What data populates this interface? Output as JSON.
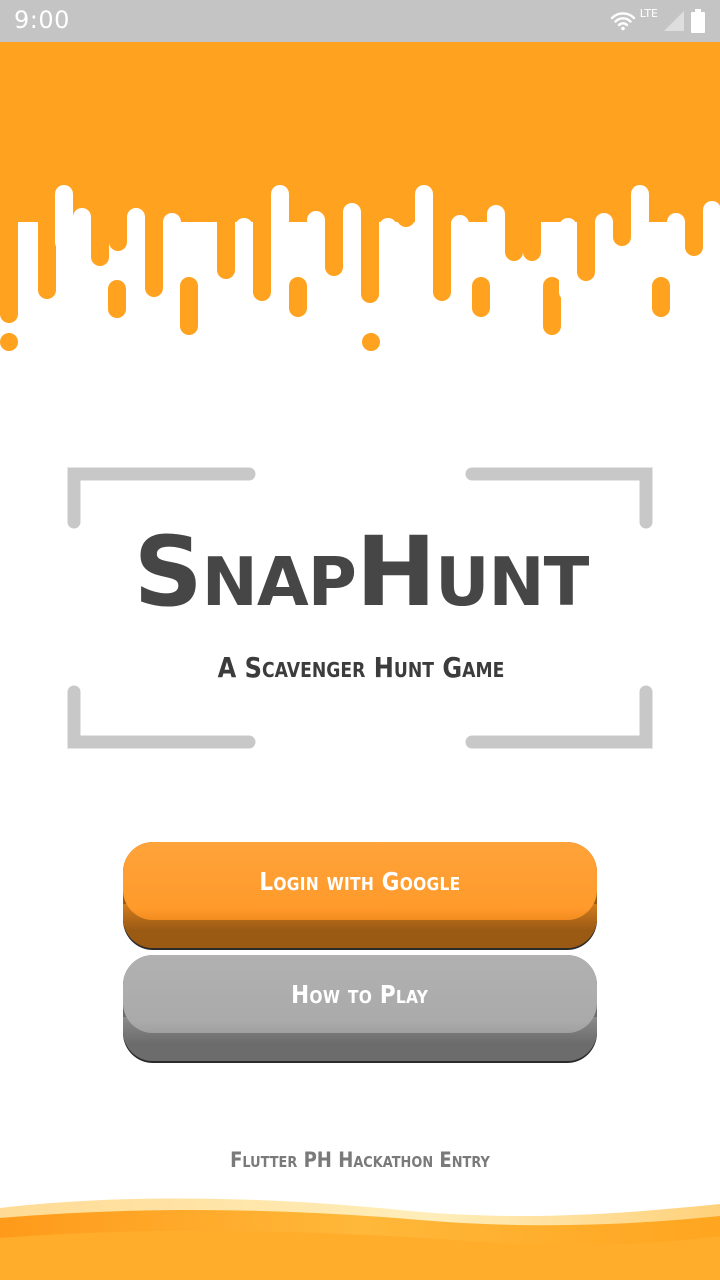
{
  "status_bar": {
    "time": "9:00",
    "network": "LTE",
    "icons": [
      "wifi-icon",
      "signal-icon",
      "battery-icon"
    ]
  },
  "logo": {
    "title": "SnapHunt",
    "subtitle": "A Scavenger Hunt Game"
  },
  "buttons": {
    "login_label": "Login with Google",
    "how_to_play_label": "How to Play"
  },
  "footer": {
    "text": "Flutter PH Hackathon Entry"
  },
  "colors": {
    "accent_orange": "#ffa21f",
    "button_orange": "#ff9a2b",
    "button_gray": "#aaaaaa",
    "logo_text": "#464646",
    "status_bar": "#c4c4c4"
  }
}
